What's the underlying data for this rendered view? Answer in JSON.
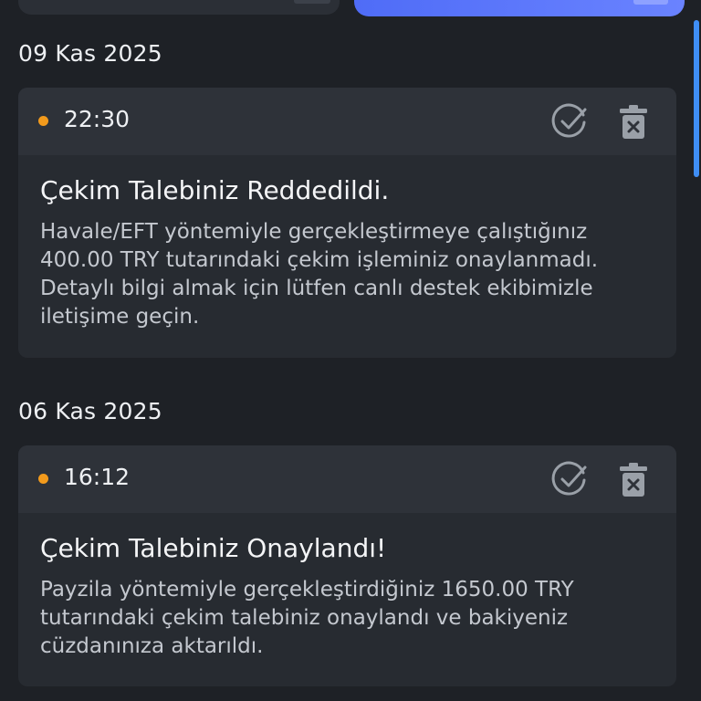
{
  "notifications": [
    {
      "date": "09 Kas 2025",
      "time": "22:30",
      "title": "Çekim Talebiniz Reddedildi.",
      "message": "Havale/EFT yöntemiyle gerçekleştirmeye çalıştığınız 400.00 TRY tutarındaki çekim işleminiz onaylanmadı. Detaylı bilgi almak için lütfen canlı destek ekibimizle iletişime geçin.",
      "unread_color": "#f29a1c"
    },
    {
      "date": "06 Kas 2025",
      "time": "16:12",
      "title": "Çekim Talebiniz Onaylandı!",
      "message": "Payzila yöntemiyle gerçekleştirdiğiniz 1650.00 TRY tutarındaki çekim talebiniz onaylandı ve bakiyeniz cüzdanınıza aktarıldı.",
      "unread_color": "#f29a1c"
    }
  ],
  "icons": {
    "mark_read": "check-circle-icon",
    "delete": "trash-icon"
  },
  "colors": {
    "accent": "#4f6cf7",
    "scrollbar": "#3f8ef5",
    "unread_dot": "#f29a1c"
  }
}
